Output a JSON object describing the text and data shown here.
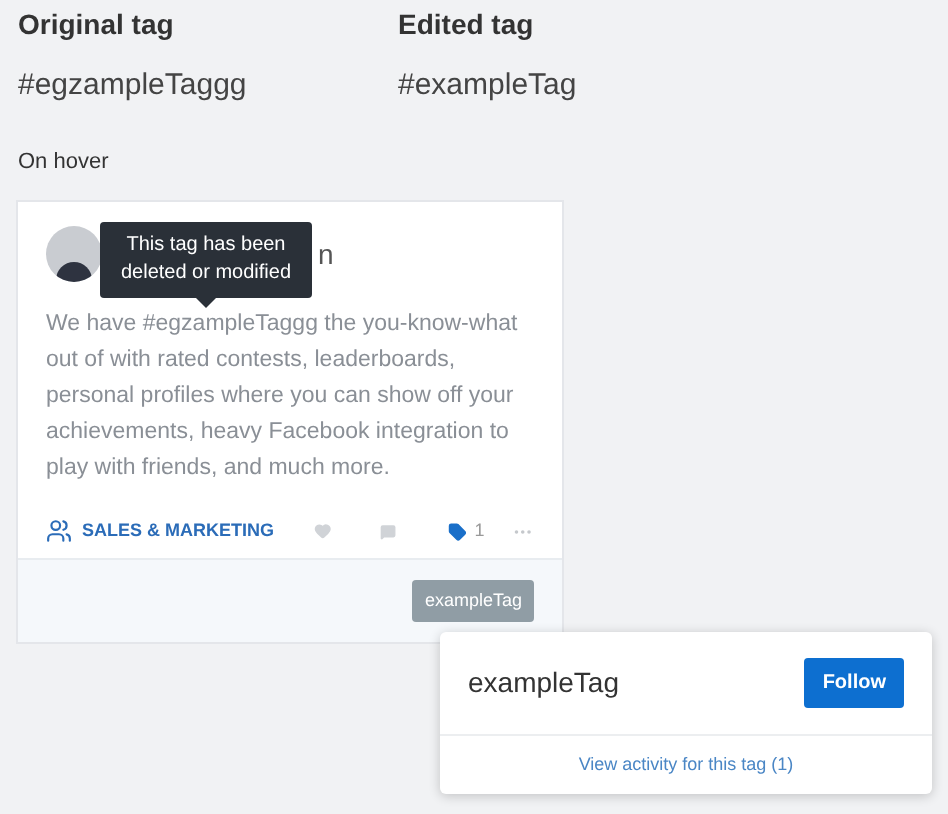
{
  "comparison": [
    {
      "heading": "Original tag",
      "tag": "#egzampleTaggg"
    },
    {
      "heading": "Edited tag",
      "tag": "#exampleTag"
    }
  ],
  "section_label": "On hover",
  "post": {
    "author_fragment": "n",
    "tooltip": "This tag has been deleted or modified",
    "body": "We have #egzampleTaggg the you-know-what out of with rated contests, leaderboards, personal profiles where you can show off your achievements, heavy Facebook integration to play with friends, and much more.",
    "group": "SALES & MARKETING",
    "tag_count": "1",
    "liked": false,
    "tag_chip": "exampleTag"
  },
  "popover": {
    "tag": "exampleTag",
    "button": "Follow",
    "link": "View activity for this tag (1)"
  }
}
